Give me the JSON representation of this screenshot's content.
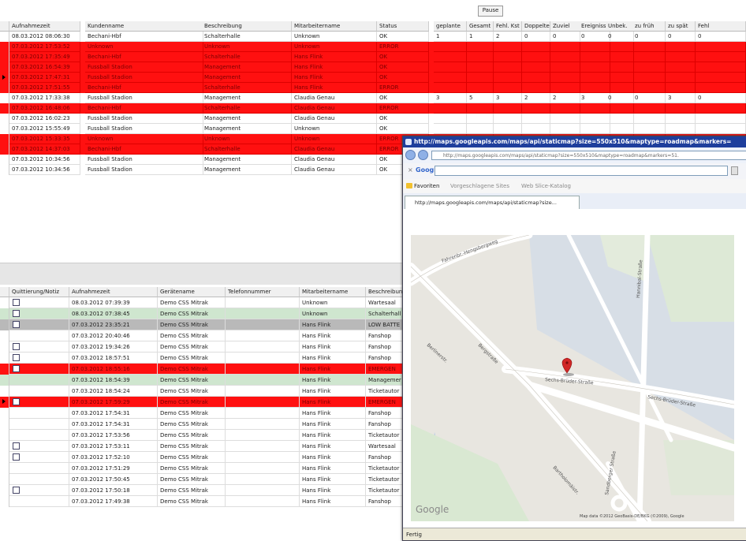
{
  "top_grid": {
    "pause_label": "Pause",
    "columns": [
      "Aufnahmezeit",
      "Kundenname",
      "Beschreibung",
      "Mitarbeitername",
      "Status",
      "geplante",
      "Gesamt",
      "Fehl. Kst",
      "Doppelte",
      "Zuviel",
      "Ereignisse",
      "Unbek.",
      "zu früh",
      "zu spät",
      "Fehl"
    ],
    "rows": [
      {
        "style": "normal",
        "cells": [
          "08.03.2012 08:06:30",
          "Bechani-Hbf",
          "Schalterhalle",
          "Unknown",
          "OK",
          "1",
          "1",
          "2",
          "0",
          "0",
          "0",
          "0",
          "0",
          "0",
          "0"
        ]
      },
      {
        "style": "red",
        "cells": [
          "07.03.2012 17:53:52",
          "Unknown",
          "Unknown",
          "Unknown",
          "ERROR",
          "",
          "",
          "",
          "",
          "",
          "",
          "",
          "",
          "",
          ""
        ]
      },
      {
        "style": "red",
        "cells": [
          "07.03.2012 17:35:49",
          "Bechani-Hbf",
          "Schalterhalle",
          "Hans Flink",
          "OK",
          "",
          "",
          "",
          "",
          "",
          "",
          "",
          "",
          "",
          ""
        ]
      },
      {
        "style": "red",
        "cells": [
          "07.03.2012 16:54:39",
          "Fussball Stadion",
          "Management",
          "Hans Flink",
          "OK",
          "",
          "",
          "",
          "",
          "",
          "",
          "",
          "",
          "",
          ""
        ]
      },
      {
        "style": "red",
        "current": true,
        "cells": [
          "07.03.2012 17:47:31",
          "Fussball Stadion",
          "Management",
          "Hans Flink",
          "OK",
          "",
          "",
          "",
          "",
          "",
          "",
          "",
          "",
          "",
          ""
        ]
      },
      {
        "style": "red",
        "cells": [
          "07.03.2012 17:51:55",
          "Bechani-Hbf",
          "Schalterhalle",
          "Hans Flink",
          "ERROR",
          "",
          "",
          "",
          "",
          "",
          "",
          "",
          "",
          "",
          ""
        ]
      },
      {
        "style": "normal",
        "cells": [
          "07.03.2012 17:33:38",
          "Fussball Stadion",
          "Management",
          "Claudia Genau",
          "OK",
          "3",
          "5",
          "3",
          "2",
          "2",
          "3",
          "0",
          "0",
          "3",
          "0"
        ]
      },
      {
        "style": "red",
        "cells": [
          "07.03.2012 16:48:06",
          "Bechani-Hbf",
          "Schalterhalle",
          "Claudia Genau",
          "ERROR",
          "",
          "",
          "",
          "",
          "",
          "",
          "",
          "",
          "",
          ""
        ]
      },
      {
        "style": "normal",
        "cells": [
          "07.03.2012 16:02:23",
          "Fussball Stadion",
          "Management",
          "Claudia Genau",
          "OK",
          "",
          "",
          "",
          "",
          "",
          "",
          "",
          "",
          "",
          ""
        ]
      },
      {
        "style": "normal",
        "cells": [
          "07.03.2012 15:55:49",
          "Fussball Stadion",
          "Management",
          "Unknown",
          "OK",
          "",
          "",
          "",
          "",
          "",
          "",
          "",
          "",
          "",
          ""
        ]
      },
      {
        "style": "red",
        "cells": [
          "07.03.2012 15:33:35",
          "Unknown",
          "Unknown",
          "Unknown",
          "ERROR",
          "",
          "",
          "",
          "",
          "",
          "",
          "",
          "",
          "",
          ""
        ]
      },
      {
        "style": "red",
        "cells": [
          "07.03.2012 14:37:03",
          "Bechani-Hbf",
          "Schalterhalle",
          "Claudia Genau",
          "ERROR",
          "",
          "",
          "",
          "",
          "",
          "",
          "",
          "",
          "",
          ""
        ]
      },
      {
        "style": "normal",
        "cells": [
          "07.03.2012 10:34:56",
          "Fussball Stadion",
          "Management",
          "Claudia Genau",
          "OK",
          "",
          "",
          "",
          "",
          "",
          "",
          "",
          "",
          "",
          ""
        ]
      },
      {
        "style": "normal",
        "cells": [
          "07.03.2012 10:34:56",
          "Fussball Stadion",
          "Management",
          "Claudia Genau",
          "OK",
          "",
          "",
          "",
          "",
          "",
          "",
          "",
          "",
          "",
          ""
        ]
      }
    ]
  },
  "bottom_grid": {
    "columns": [
      "Quittierung/Notiz",
      "Aufnahmezeit",
      "Gerätename",
      "Telefonnummer",
      "Mitarbeitername",
      "Beschreibung"
    ],
    "rows": [
      {
        "style": "normal",
        "checkbox": true,
        "cells": [
          "08.03.2012 07:39:39",
          "Demo CSS Mitrak",
          "",
          "Unknown",
          "Wartesaal"
        ]
      },
      {
        "style": "green",
        "checkbox": true,
        "cells": [
          "08.03.2012 07:38:45",
          "Demo CSS Mitrak",
          "",
          "Unknown",
          "Schalterhall"
        ]
      },
      {
        "style": "gray",
        "checkbox": true,
        "cells": [
          "07.03.2012 23:35:21",
          "Demo CSS Mitrak",
          "",
          "Hans Flink",
          "LOW BATTE"
        ]
      },
      {
        "style": "normal",
        "checkbox": false,
        "cells": [
          "07.03.2012 20:40:46",
          "Demo CSS Mitrak",
          "",
          "Hans Flink",
          "Fanshop"
        ]
      },
      {
        "style": "normal",
        "checkbox": true,
        "cells": [
          "07.03.2012 19:34:26",
          "Demo CSS Mitrak",
          "",
          "Hans Flink",
          "Fanshop"
        ]
      },
      {
        "style": "normal",
        "checkbox": true,
        "cells": [
          "07.03.2012 18:57:51",
          "Demo CSS Mitrak",
          "",
          "Hans Flink",
          "Fanshop"
        ]
      },
      {
        "style": "red",
        "checkbox": true,
        "cells": [
          "07.03.2012 18:55:16",
          "Demo CSS Mitrak",
          "",
          "Hans Flink",
          "EMERGEN"
        ]
      },
      {
        "style": "green",
        "checkbox": false,
        "cells": [
          "07.03.2012 18:54:39",
          "Demo CSS Mitrak",
          "",
          "Hans Flink",
          "Managemer"
        ]
      },
      {
        "style": "normal",
        "checkbox": false,
        "cells": [
          "07.03.2012 18:54:24",
          "Demo CSS Mitrak",
          "",
          "Hans Flink",
          "Ticketautor"
        ]
      },
      {
        "style": "red",
        "checkbox": true,
        "current": true,
        "cells": [
          "07.03.2012 17:59:29",
          "Demo CSS Mitrak",
          "",
          "Hans Flink",
          "EMERGEN"
        ]
      },
      {
        "style": "normal",
        "checkbox": false,
        "cells": [
          "07.03.2012 17:54:31",
          "Demo CSS Mitrak",
          "",
          "Hans Flink",
          "Fanshop"
        ]
      },
      {
        "style": "normal",
        "checkbox": false,
        "cells": [
          "07.03.2012 17:54:31",
          "Demo CSS Mitrak",
          "",
          "Hans Flink",
          "Fanshop"
        ]
      },
      {
        "style": "normal",
        "checkbox": false,
        "cells": [
          "07.03.2012 17:53:56",
          "Demo CSS Mitrak",
          "",
          "Hans Flink",
          "Ticketautor"
        ]
      },
      {
        "style": "normal",
        "checkbox": true,
        "cells": [
          "07.03.2012 17:53:11",
          "Demo CSS Mitrak",
          "",
          "Hans Flink",
          "Wartesaal"
        ]
      },
      {
        "style": "normal",
        "checkbox": true,
        "cells": [
          "07.03.2012 17:52:10",
          "Demo CSS Mitrak",
          "",
          "Hans Flink",
          "Fanshop"
        ]
      },
      {
        "style": "normal",
        "checkbox": false,
        "cells": [
          "07.03.2012 17:51:29",
          "Demo CSS Mitrak",
          "",
          "Hans Flink",
          "Ticketautor"
        ]
      },
      {
        "style": "normal",
        "checkbox": false,
        "cells": [
          "07.03.2012 17:50:45",
          "Demo CSS Mitrak",
          "",
          "Hans Flink",
          "Ticketautor"
        ]
      },
      {
        "style": "normal",
        "checkbox": true,
        "cells": [
          "07.03.2012 17:50:18",
          "Demo CSS Mitrak",
          "",
          "Hans Flink",
          "Ticketautor"
        ]
      },
      {
        "style": "normal",
        "checkbox": false,
        "cells": [
          "07.03.2012 17:49:38",
          "Demo CSS Mitrak",
          "",
          "Hans Flink",
          "Fanshop"
        ]
      }
    ]
  },
  "popup": {
    "title": "http://maps.googleapis.com/maps/api/staticmap?size=550x510&maptype=roadmap&markers=",
    "url": "http://maps.googleapis.com/maps/api/staticmap?size=550x510&maptype=roadmap&markers=51.",
    "search_label": "Google",
    "favorites_label": "Favoriten",
    "suggested_sites": "Vorgeschlagene Sites",
    "web_slice": "Web Slice-Katalog",
    "tab_label": "http://maps.googleapis.com/maps/api/staticmap?size...",
    "status_text": "Fertig",
    "map": {
      "streets": [
        "Fahrenbr.-Hengsbergweg",
        "Berlinerstr.",
        "Sechs-Brüder-Straße",
        "Sechs-Brüder-Straße",
        "Bergstraße",
        "Bartholomäistr.",
        "Sandberger Straße",
        "Hannibal-Straße"
      ],
      "logo": "Google",
      "copyright": "Map data ©2012 GeoBasis-DE/BKG (©2009), Google"
    }
  },
  "colors": {
    "error_row": "#ff1010",
    "ok_green": "#cfe6cf",
    "battery_gray": "#b9b9b9",
    "title_bar": "#1e3e9c"
  }
}
